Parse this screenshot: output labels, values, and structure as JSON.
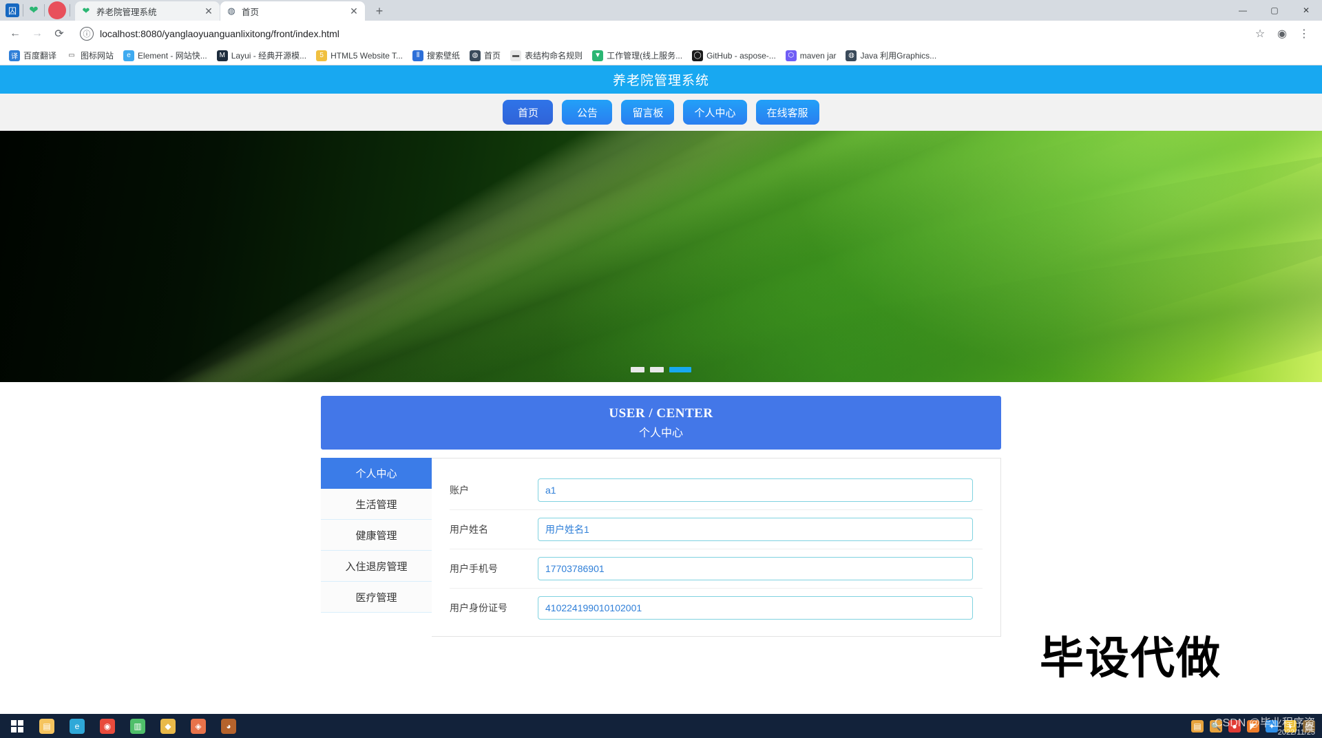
{
  "browser": {
    "tabs": [
      {
        "title": "养老院管理系统",
        "favicon": "leaf-icon",
        "active": false,
        "close_label": "✕"
      },
      {
        "title": "首页",
        "favicon": "globe-icon",
        "active": true,
        "close_label": "✕"
      }
    ],
    "new_tab_label": "+",
    "window_controls": {
      "minimize": "—",
      "maximize": "▢",
      "close": "✕"
    },
    "nav": {
      "back": "←",
      "forward": "→",
      "reload": "⟳"
    },
    "omnibox": {
      "info_icon": "ⓘ",
      "url": "localhost:8080/yanglaoyuanguanlixitong/front/index.html",
      "star": "☆",
      "profile": "◉",
      "menu": "⋮"
    },
    "bookmarks": [
      {
        "label": "百度翻译",
        "icon_color": "#2f7fd8",
        "glyph": "译"
      },
      {
        "label": "图标网站",
        "icon_color": "#ffffff",
        "glyph": "▭"
      },
      {
        "label": "Element - 网站快...",
        "icon_color": "#3eaaf0",
        "glyph": "e"
      },
      {
        "label": "Layui - 经典开源模...",
        "icon_color": "#1e2d3d",
        "glyph": "M"
      },
      {
        "label": "HTML5 Website T...",
        "icon_color": "#f0c040",
        "glyph": "5"
      },
      {
        "label": "搜索壁纸",
        "icon_color": "#2d6fd8",
        "glyph": "⦀"
      },
      {
        "label": "首页",
        "icon_color": "#3a4a5a",
        "glyph": "◍"
      },
      {
        "label": "表结构命名规则",
        "icon_color": "#e9e9e9",
        "glyph": "▬"
      },
      {
        "label": "工作管理(线上服务...",
        "icon_color": "#2bb673",
        "glyph": "▼"
      },
      {
        "label": "GitHub - aspose-...",
        "icon_color": "#1a1a1a",
        "glyph": "◯"
      },
      {
        "label": "maven jar",
        "icon_color": "#6f5df5",
        "glyph": "⬡"
      },
      {
        "label": "Java 利用Graphics...",
        "icon_color": "#3a4a5a",
        "glyph": "◍"
      }
    ]
  },
  "site": {
    "title": "养老院管理系统",
    "nav": [
      {
        "label": "首页",
        "active": true
      },
      {
        "label": "公告",
        "active": false
      },
      {
        "label": "留言板",
        "active": false
      },
      {
        "label": "个人中心",
        "active": false
      },
      {
        "label": "在线客服",
        "active": false
      }
    ],
    "carousel": {
      "slides": 3,
      "active_index": 2
    },
    "user_center": {
      "title_en": "USER / CENTER",
      "title_cn": "个人中心",
      "sidebar": [
        {
          "label": "个人中心",
          "active": true
        },
        {
          "label": "生活管理",
          "active": false
        },
        {
          "label": "健康管理",
          "active": false
        },
        {
          "label": "入住退房管理",
          "active": false
        },
        {
          "label": "医疗管理",
          "active": false
        }
      ],
      "fields": [
        {
          "label": "账户",
          "value": "a1"
        },
        {
          "label": "用户姓名",
          "value": "用户姓名1"
        },
        {
          "label": "用户手机号",
          "value": "17703786901"
        },
        {
          "label": "用户身份证号",
          "value": "410224199010102001"
        }
      ]
    },
    "watermark": "毕设代做"
  },
  "taskbar": {
    "start_label": "start-button",
    "items": [
      {
        "name": "file-explorer",
        "color": "#f5c45e",
        "glyph": "▤"
      },
      {
        "name": "edge-browser",
        "color": "#2fa8d8",
        "glyph": "e"
      },
      {
        "name": "chrome-browser",
        "color": "#e84b3c",
        "glyph": "◉"
      },
      {
        "name": "notepad-app",
        "color": "#4fbf6a",
        "glyph": "▥"
      },
      {
        "name": "app-yellow",
        "color": "#e9b949",
        "glyph": "◆"
      },
      {
        "name": "app-orange",
        "color": "#e8734a",
        "glyph": "◈"
      },
      {
        "name": "app-brown",
        "color": "#b5632c",
        "glyph": "◕"
      }
    ],
    "tray": [
      {
        "name": "tray-window",
        "color": "#e8a33d",
        "glyph": "▤"
      },
      {
        "name": "tray-search",
        "color": "#e8a33d",
        "glyph": "🔍"
      },
      {
        "name": "tray-red-app",
        "color": "#e03b34",
        "glyph": "●"
      },
      {
        "name": "tray-orange-app",
        "color": "#ef7d2a",
        "glyph": "◤"
      },
      {
        "name": "tray-blue-app",
        "color": "#2f8fe8",
        "glyph": "✦"
      },
      {
        "name": "tray-yellow-app",
        "color": "#edc13a",
        "glyph": "◗"
      },
      {
        "name": "tray-brown-app",
        "color": "#8a6a3a",
        "glyph": "▨"
      }
    ],
    "watermark": "CSDN @毕业程序资",
    "date": "2022/11/25"
  }
}
